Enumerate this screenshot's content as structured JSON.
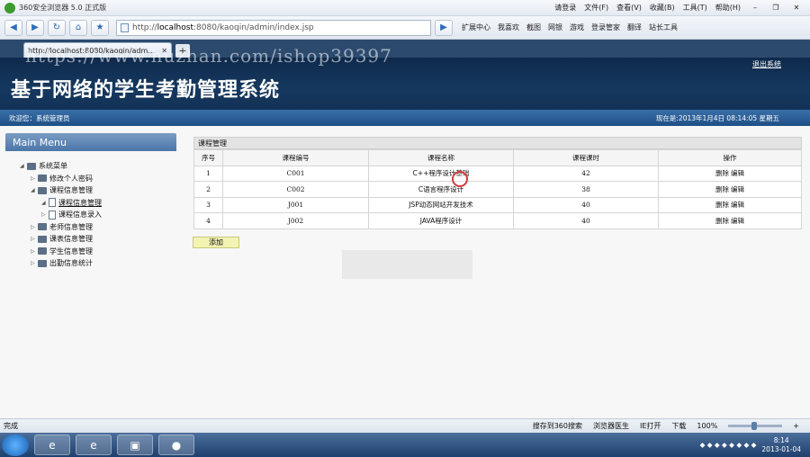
{
  "browser": {
    "title": "360安全浏览器 5.0 正式版",
    "menus": [
      "请登录",
      "文件(F)",
      "查看(V)",
      "收藏(B)",
      "工具(T)",
      "帮助(H)"
    ],
    "address_scheme": "http://",
    "address_host": "localhost",
    "address_rest": ":8080/kaoqin/admin/index.jsp",
    "toolbar_items": [
      "扩展中心",
      "我喜欢",
      "截图",
      "网银",
      "游戏",
      "登录管家",
      "翻译",
      "站长工具"
    ],
    "tab_title": "http://localhost:8080/kaoqin/adm...",
    "status_done": "完成",
    "status_items": [
      "搜存到360搜索",
      "浏览器医生",
      "IE打开",
      "下载"
    ],
    "zoom": "100%"
  },
  "watermark": "https://www.huzhan.com/ishop39397",
  "header": {
    "system_title": "基于网络的学生考勤管理系统",
    "logout": "退出系统",
    "welcome": "欢迎您：系统管理员",
    "current_time": "现在是:2013年1月4日  08:14:05 星期五"
  },
  "sidebar": {
    "menu_head": "Main Menu",
    "root": "系统菜单",
    "items": [
      {
        "label": "修改个人密码"
      },
      {
        "label": "课程信息管理"
      },
      {
        "label": "课程信息管理"
      },
      {
        "label": "课程信息录入"
      },
      {
        "label": "老师信息管理"
      },
      {
        "label": "课表信息管理"
      },
      {
        "label": "学生信息管理"
      },
      {
        "label": "出勤信息统计"
      }
    ]
  },
  "main": {
    "panel_title": "课程管理",
    "columns": [
      "序号",
      "课程编号",
      "课程名称",
      "课程课时",
      "操作"
    ],
    "rows": [
      {
        "index": "1",
        "code": "C001",
        "name": "C++程序设计基础",
        "hours": "42"
      },
      {
        "index": "2",
        "code": "C002",
        "name": "C语言程序设计",
        "hours": "38"
      },
      {
        "index": "3",
        "code": "J001",
        "name": "JSP动态网站开发技术",
        "hours": "40"
      },
      {
        "index": "4",
        "code": "J002",
        "name": "JAVA程序设计",
        "hours": "40"
      }
    ],
    "op_delete": "删除",
    "op_edit": "编辑",
    "add_label": "添加"
  },
  "taskbar": {
    "clock_time": "8:14",
    "clock_date": "2013-01-04"
  }
}
